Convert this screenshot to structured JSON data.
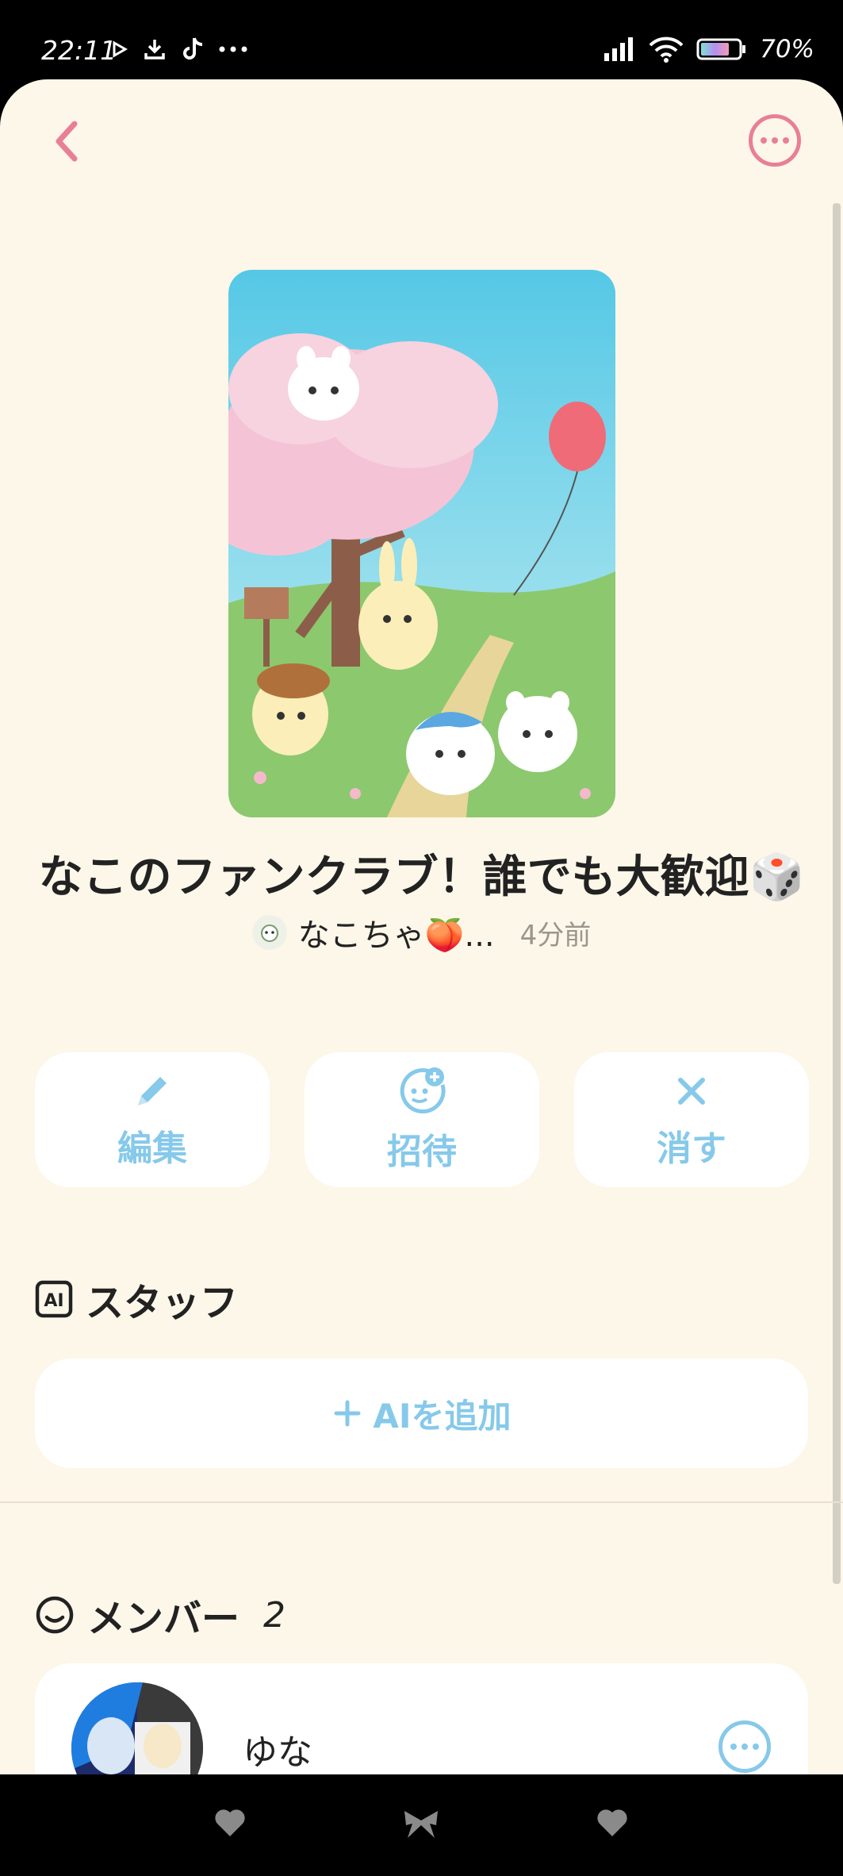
{
  "status_bar": {
    "time": "22:11",
    "battery": "70%",
    "left_icons": [
      "play-icon",
      "download-icon",
      "tiktok-icon",
      "more-dots-icon"
    ],
    "right_icons": [
      "signal-icon",
      "wifi-icon",
      "battery-icon"
    ]
  },
  "header": {
    "back_icon": "chevron-left-icon",
    "more_icon": "more-horizontal-icon"
  },
  "group": {
    "title": "なこのファンクラブ！誰でも大歓迎🎲",
    "author_name": "なこちゃ🍑...",
    "time_ago": "4分前"
  },
  "actions": [
    {
      "label": "編集",
      "icon": "pencil-icon"
    },
    {
      "label": "招待",
      "icon": "invite-face-icon"
    },
    {
      "label": "消す",
      "icon": "close-icon"
    }
  ],
  "staff": {
    "title": "スタッフ",
    "icon": "ai-badge-icon",
    "add_label": "AIを追加"
  },
  "members": {
    "title": "メンバー",
    "count": "2",
    "icon": "smile-icon",
    "items": [
      {
        "name": "ゆな"
      }
    ]
  },
  "nav_bar": {
    "icons": [
      "heart-icon",
      "ribbon-icon",
      "heart-icon"
    ]
  },
  "colors": {
    "background": "#fdf7e9",
    "accent_pink": "#e87f96",
    "accent_blue": "#86c9ea",
    "card": "#ffffff"
  }
}
